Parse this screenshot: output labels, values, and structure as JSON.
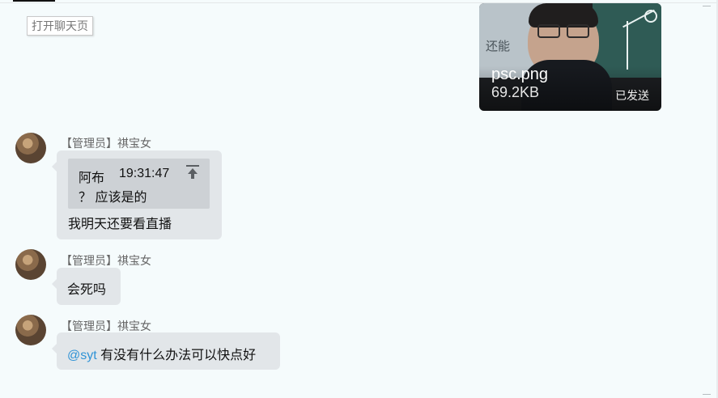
{
  "top": {
    "open_chat_label": "打开聊天页"
  },
  "file_message": {
    "file_name": "psc.png",
    "file_size": "69.2KB",
    "status": "已发送",
    "image_text": "还能"
  },
  "messages": [
    {
      "sender": "【管理员】祺宝女",
      "quote": {
        "author": "阿布",
        "time": "19:31:47",
        "text": "？ 应该是的"
      },
      "text": "我明天还要看直播"
    },
    {
      "sender": "【管理员】祺宝女",
      "text": "会死吗"
    },
    {
      "sender": "【管理员】祺宝女",
      "mention": "@syt",
      "text": "有没有什么办法可以快点好"
    }
  ]
}
